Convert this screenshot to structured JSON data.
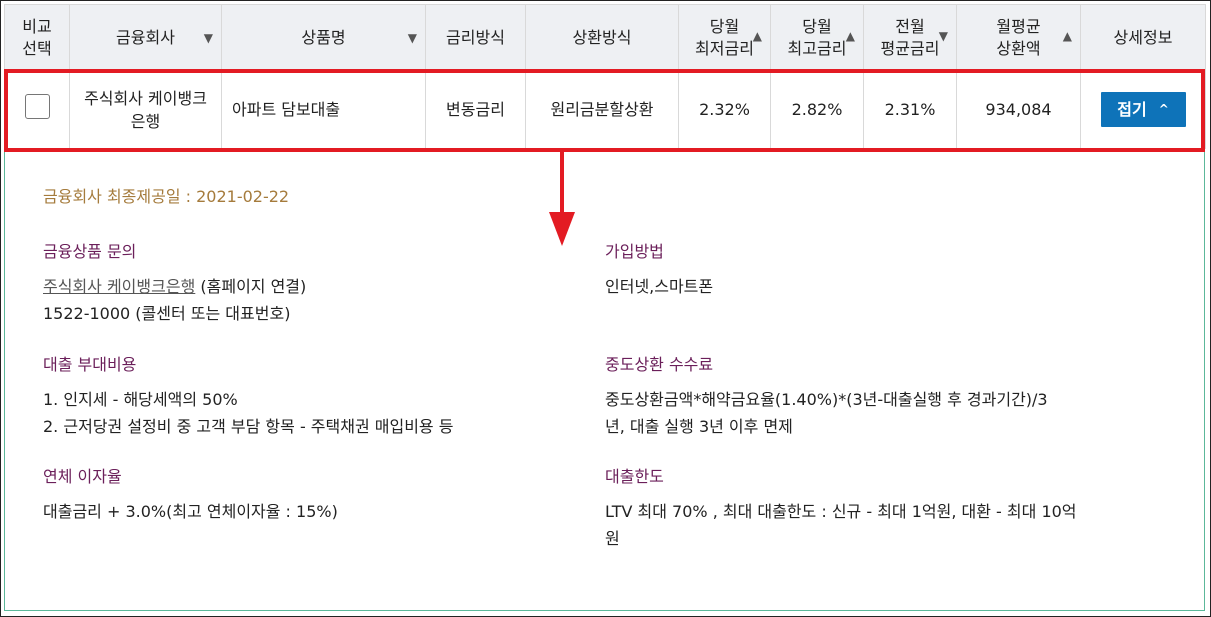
{
  "table": {
    "headers": {
      "compare": [
        "비교",
        "선택"
      ],
      "company": "금융회사",
      "product": "상품명",
      "rate_type": "금리방식",
      "repay": "상환방식",
      "min_rate": [
        "당월",
        "최저금리"
      ],
      "max_rate": [
        "당월",
        "최고금리"
      ],
      "avg_rate": [
        "전월",
        "평균금리"
      ],
      "monthly": [
        "월평균",
        "상환액"
      ],
      "detail": "상세정보"
    },
    "sort_icons": {
      "company": "▼",
      "product": "▼",
      "min_rate": "▲",
      "max_rate": "▲",
      "avg_rate": "▼",
      "monthly": "▲"
    },
    "row": {
      "company": [
        "주식회사 케이뱅크",
        "은행"
      ],
      "product": "아파트 담보대출",
      "rate_type": "변동금리",
      "repay": "원리금분할상환",
      "min_rate": "2.32%",
      "max_rate": "2.82%",
      "avg_rate": "2.31%",
      "monthly": "934,084",
      "fold_label": "접기",
      "fold_icon": "^"
    }
  },
  "detail": {
    "provide_date": "금융회사 최종제공일 : 2021-02-22",
    "inquiry": {
      "title": "금융상품 문의",
      "link": "주식회사 케이뱅크은행",
      "link_suffix": " (홈페이지 연결)",
      "phone": "1522-1000 (콜센터 또는 대표번호)"
    },
    "join": {
      "title": "가입방법",
      "body": "인터넷,스마트폰"
    },
    "extra_cost": {
      "title": "대출 부대비용",
      "line1": "1. 인지세 - 해당세액의 50%",
      "line2": "2. 근저당권 설정비 중 고객 부담 항목 - 주택채권 매입비용 등"
    },
    "early_fee": {
      "title": "중도상환 수수료",
      "line1": "중도상환금액*해약금요율(1.40%)*(3년-대출실행 후 경과기간)/3",
      "line2": "년, 대출 실행 3년 이후 면제"
    },
    "overdue": {
      "title": "연체 이자율",
      "body": "대출금리 + 3.0%(최고 연체이자율 : 15%)"
    },
    "limit": {
      "title": "대출한도",
      "line1": "LTV 최대 70% , 최대 대출한도 : 신규 - 최대 1억원, 대환 - 최대 10억",
      "line2": "원"
    }
  },
  "colors": {
    "highlight": "#e31b23",
    "button": "#0e73b9",
    "section_title": "#6b1f5a",
    "date_text": "#a57b3c",
    "detail_border": "#5cb89a"
  }
}
